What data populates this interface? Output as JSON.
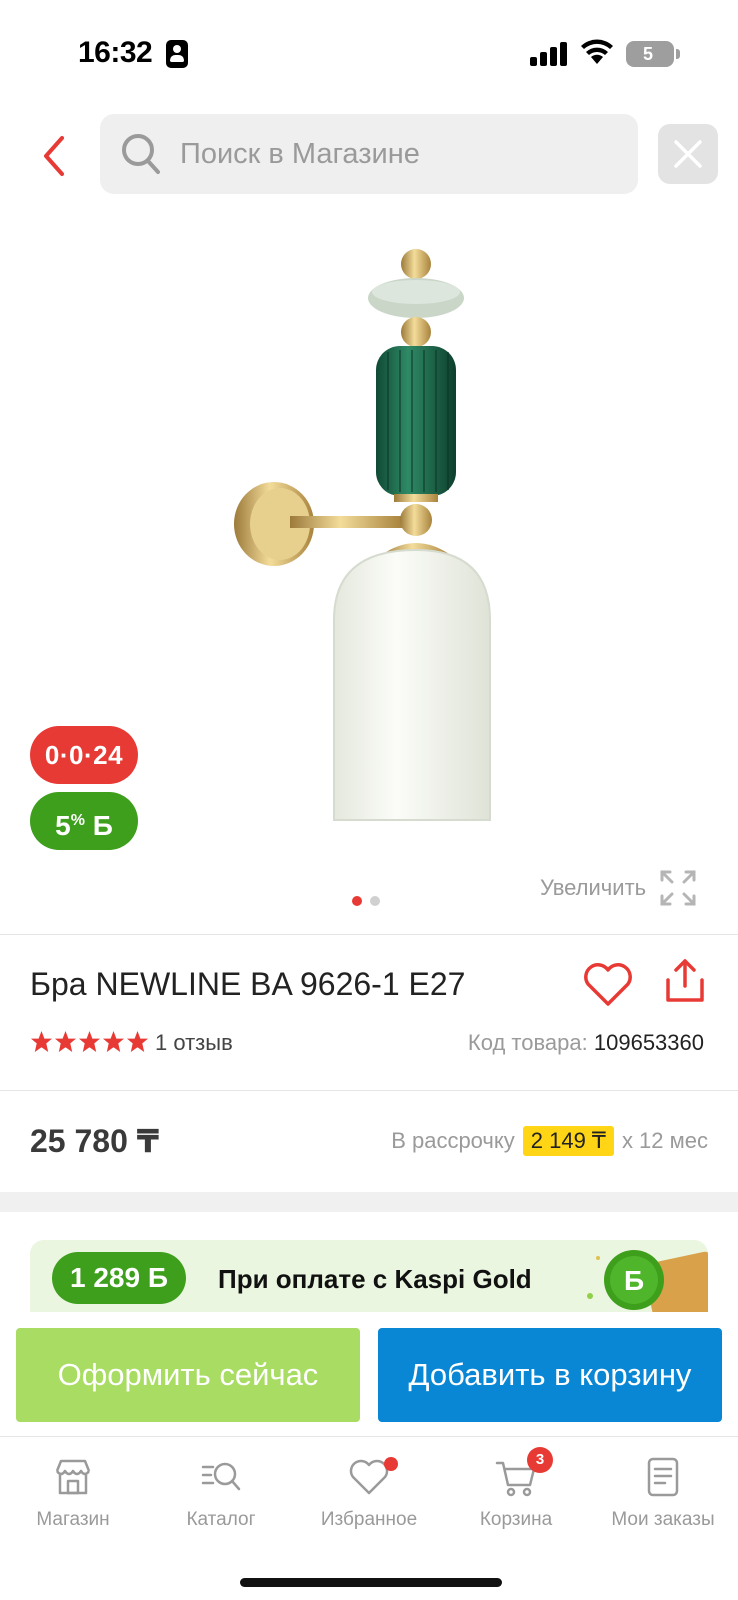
{
  "status_bar": {
    "time": "16:32",
    "battery": "5"
  },
  "search": {
    "placeholder": "Поиск в Магазине",
    "value": ""
  },
  "gallery": {
    "badge_installment": "0·0·24",
    "badge_bonus_percent": "5",
    "badge_bonus_pct_sign": "%",
    "badge_bonus_currency": "Б",
    "zoom_label": "Увеличить",
    "slide_count": 2,
    "active_slide": 1
  },
  "product": {
    "title": "Бра NEWLINE BA 9626-1 E27",
    "rating": 5,
    "reviews_label": "1 отзыв",
    "sku_label": "Код товара:",
    "sku_value": "109653360",
    "price": "25 780 ₸",
    "installment_prefix": "В рассрочку",
    "installment_amount": "2 149 ₸",
    "installment_suffix": "х 12 мес"
  },
  "kaspi_gold": {
    "bonus": "1 289 Б",
    "text": "При оплате с Kaspi Gold"
  },
  "actions": {
    "buy_now": "Оформить сейчас",
    "add_to_cart": "Добавить в корзину"
  },
  "nav": {
    "items": [
      {
        "label": "Магазин",
        "icon": "shop-icon"
      },
      {
        "label": "Каталог",
        "icon": "catalog-search-icon"
      },
      {
        "label": "Избранное",
        "icon": "heart-icon"
      },
      {
        "label": "Корзина",
        "icon": "cart-icon",
        "badge": "3"
      },
      {
        "label": "Мои заказы",
        "icon": "orders-icon"
      }
    ]
  },
  "colors": {
    "accent_red": "#e83a35",
    "bonus_green": "#3d9f1b",
    "buy_green": "#a8dc62",
    "cart_blue": "#0a87d4",
    "highlight_yellow": "#ffd515"
  }
}
